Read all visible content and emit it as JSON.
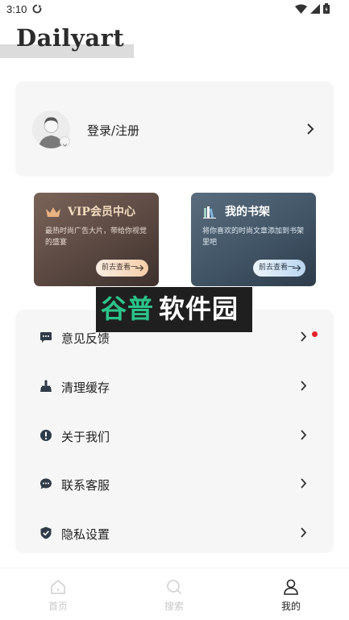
{
  "status_bar": {
    "time": "3:10"
  },
  "brand": {
    "name": "Dailyart"
  },
  "login": {
    "label": "登录/注册"
  },
  "promos": {
    "vip": {
      "title": "VIP会员中心",
      "desc": "最热时尚广告大片，带给你视觉的盛宴",
      "button": "前去查看一"
    },
    "shelf": {
      "title": "我的书架",
      "desc": "将你喜欢的时尚文章添加到书架里吧",
      "button": "前去查看一"
    }
  },
  "menu": {
    "items": [
      {
        "label": "意见反馈",
        "icon": "chat-icon",
        "has_dot": true
      },
      {
        "label": "清理缓存",
        "icon": "broom-icon"
      },
      {
        "label": "关于我们",
        "icon": "info-icon"
      },
      {
        "label": "联系客服",
        "icon": "support-chat-icon"
      },
      {
        "label": "隐私设置",
        "icon": "shield-check-icon"
      }
    ]
  },
  "watermark": {
    "part_a": "谷普",
    "part_b": "软件园"
  },
  "tabs": [
    {
      "label": "首页",
      "icon": "home-icon",
      "active": false
    },
    {
      "label": "搜索",
      "icon": "search-icon",
      "active": false
    },
    {
      "label": "我的",
      "icon": "user-icon",
      "active": true
    }
  ],
  "colors": {
    "accent_red": "#e5202e",
    "card_bg": "#f6f6f6",
    "vip_gold": "#f3dcbf",
    "watermark_green": "#2bc48a"
  }
}
